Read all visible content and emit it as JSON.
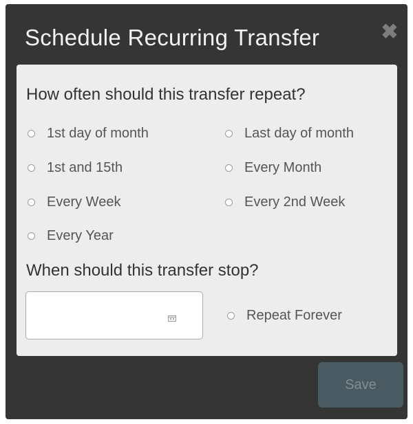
{
  "dialog": {
    "title": "Schedule Recurring Transfer",
    "close_icon": "close-icon"
  },
  "frequency": {
    "question": "How often should this transfer repeat?",
    "options": [
      {
        "label": "1st day of month",
        "selected": false
      },
      {
        "label": "Last day of month",
        "selected": false
      },
      {
        "label": "1st and 15th",
        "selected": false
      },
      {
        "label": "Every Month",
        "selected": false
      },
      {
        "label": "Every Week",
        "selected": false
      },
      {
        "label": "Every 2nd Week",
        "selected": false
      },
      {
        "label": "Every Year",
        "selected": false
      }
    ]
  },
  "stop": {
    "question": "When should this transfer stop?",
    "end_date_value": "",
    "calendar_icon": "calendar-icon",
    "repeat_forever": {
      "label": "Repeat Forever",
      "selected": false
    }
  },
  "footer": {
    "save_label": "Save",
    "save_enabled": false
  },
  "colors": {
    "dialog_background": "#353535",
    "body_background": "#ededed",
    "save_button": "#4a5a62"
  }
}
